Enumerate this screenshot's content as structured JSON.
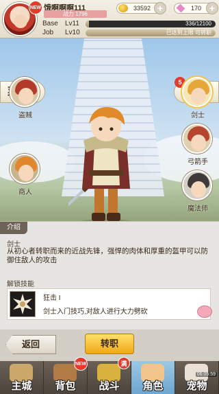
{
  "player": {
    "name": "饿啊啊啊111",
    "power": "战力 1796",
    "new_badge": "NEW",
    "base_label": "Base",
    "base_level": "Lv11",
    "base_exp": "336/12100",
    "base_progress": 0.028,
    "job_label": "Job",
    "job_level": "Lv10",
    "job_exp": "已达到上限 可转职",
    "job_progress": 1.0
  },
  "currency": {
    "gold": "33592",
    "gems": "170"
  },
  "scene": {
    "menu_label": "菜单",
    "task_label": "任务",
    "task_count": "5",
    "jobs_left": [
      {
        "label": "盗贼",
        "hair": "#b23a2a"
      },
      {
        "label": "商人",
        "hair": "#e2872e"
      }
    ],
    "jobs_right": [
      {
        "label": "剑士",
        "hair": "#e5a63a"
      },
      {
        "label": "弓箭手",
        "hair": "#b6452f"
      },
      {
        "label": "魔法师",
        "hair": "#3e3a3a"
      }
    ]
  },
  "intro": {
    "tab_label": "介绍",
    "job_name": "剑士",
    "description": "从初心者转职而来的近战先锋，强悍的肉体和厚重的盔甲可以防御住敌人的攻击",
    "unlock_title": "解锁技能",
    "skill_name": "狂击 I",
    "skill_desc": "剑士入门技巧,对敌人进行大力劈砍"
  },
  "actions": {
    "back_label": "返回",
    "transfer_label": "转职"
  },
  "nav": {
    "items": [
      {
        "label": "主城",
        "color": "#c9a86a"
      },
      {
        "label": "背包",
        "color": "#b07b45"
      },
      {
        "label": "战斗",
        "color": "#d9b23e"
      },
      {
        "label": "角色",
        "color": "#f0c48a"
      },
      {
        "label": "宠物",
        "color": "#e8e1d4"
      }
    ],
    "new_badge": "NEW",
    "full_badge": "满",
    "pet_timer": "06:05:59"
  }
}
